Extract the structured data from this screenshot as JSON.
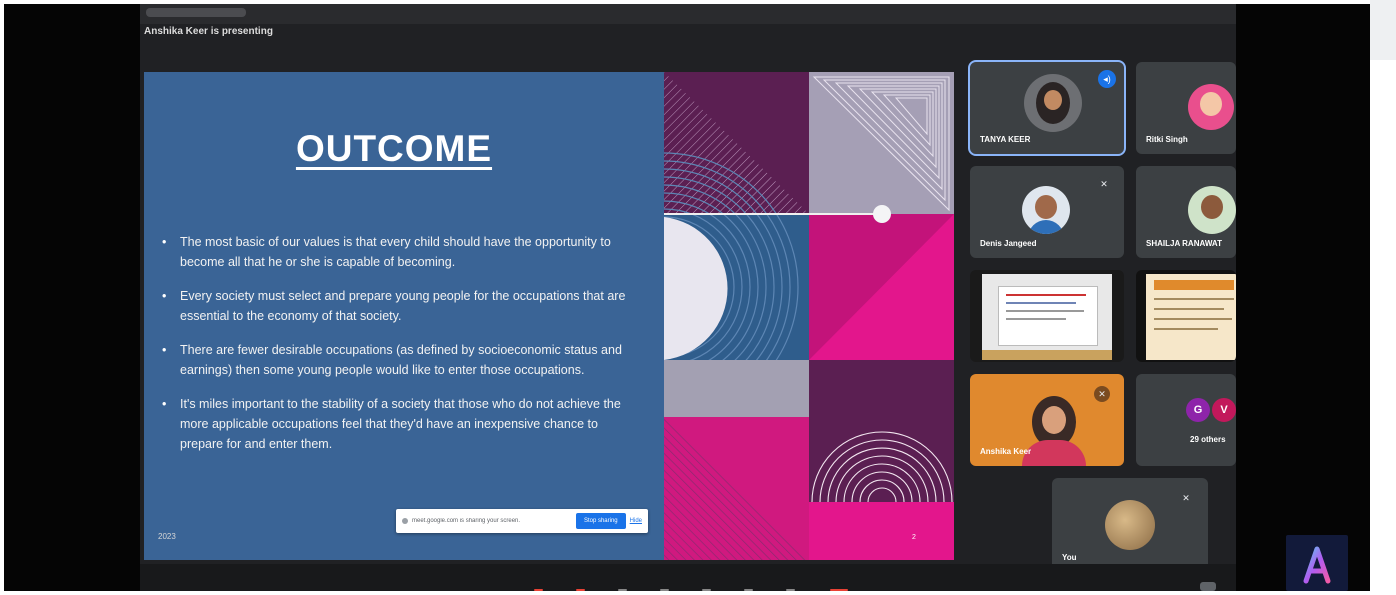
{
  "meeting": {
    "presenting_label": "Anshika Keer is presenting",
    "you_label": "You",
    "others_count_label": "29 others"
  },
  "slide": {
    "title": "OUTCOME",
    "bullets": [
      "The most basic of our values is that every child should have the opportunity to become all that he or she is capable of becoming.",
      "Every society must select and prepare young people for the occupations that are essential to the economy of that society.",
      "There are fewer desirable occupations (as defined by socioeconomic status and earnings) then some young people would like to enter those occupations.",
      "It's miles important to the stability of a society that those who do not achieve the more applicable occupations feel that they'd have an inexpensive chance to prepare for and enter them."
    ],
    "year": "2023",
    "page_number": "2",
    "colors": {
      "background": "#3a6496",
      "magenta": "#e3168c",
      "plum": "#5b1f52",
      "lilac": "#a59fb5"
    }
  },
  "share_bar": {
    "message": "meet.google.com is sharing your screen.",
    "stop_label": "Stop sharing",
    "hide_label": "Hide"
  },
  "participants": [
    {
      "name": "TANYA KEER",
      "speaking": true
    },
    {
      "name": "Ritki Singh"
    },
    {
      "name": "Denis Jangeed"
    },
    {
      "name": "SHAILJA RANAWAT"
    },
    {
      "name": "Anshika Keer"
    },
    {
      "name": "You"
    }
  ],
  "others": {
    "initials": [
      "G",
      "V"
    ],
    "colors": [
      "#8e24aa",
      "#c2185b"
    ]
  },
  "icons": {
    "mic_off": "mic-off-icon",
    "speaking": "volume-icon",
    "app_logo": "letter-a-logo-icon"
  },
  "accent": "#1a73e8"
}
